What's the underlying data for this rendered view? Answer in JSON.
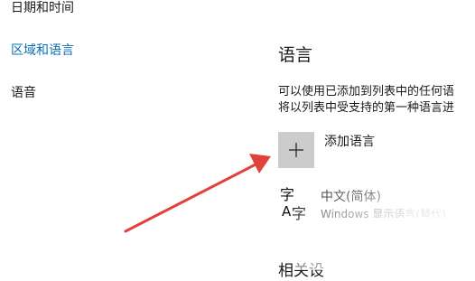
{
  "sidebar": {
    "items": [
      {
        "label": "日期和时间"
      },
      {
        "label": "区域和语言",
        "selected": true
      },
      {
        "label": "语音"
      }
    ]
  },
  "main": {
    "title": "语言",
    "description_lines": [
      "可以使用已添加到列表中的任何语",
      "将以列表中受支持的第一种语言进"
    ],
    "add_language_label": "添加语言",
    "add_icon": "plus-icon",
    "languages": [
      {
        "name": "中文(简体)",
        "subtitle": "Windows 显示语言(替代)",
        "icon": "language-icon"
      }
    ],
    "related_heading": "相关设"
  },
  "annotation": {
    "type": "arrow",
    "color": "#e0413a"
  },
  "colors": {
    "accent": "#0a6fb3",
    "tile": "#cccccc"
  }
}
